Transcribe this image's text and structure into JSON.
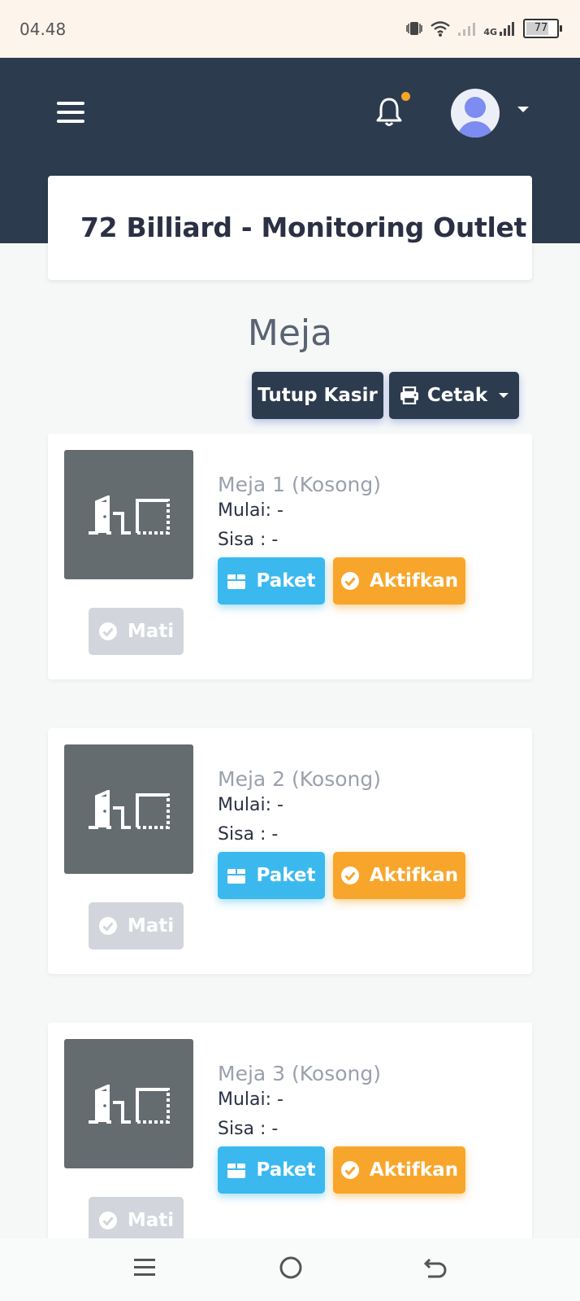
{
  "status_bar": {
    "time": "04.48",
    "network_label": "4G",
    "battery_level": "77"
  },
  "header": {
    "page_title": "72 Billiard - Monitoring Outlet",
    "has_notification": true
  },
  "main": {
    "section_title": "Meja",
    "tutup_kasir_label": "Tutup Kasir",
    "cetak_label": "Cetak",
    "tables": [
      {
        "name": "Meja 1 (Kosong)",
        "mulai": "Mulai: -",
        "sisa": "Sisa : -",
        "paket_label": "Paket",
        "aktifkan_label": "Aktifkan",
        "mati_label": "Mati"
      },
      {
        "name": "Meja 2 (Kosong)",
        "mulai": "Mulai: -",
        "sisa": "Sisa : -",
        "paket_label": "Paket",
        "aktifkan_label": "Aktifkan",
        "mati_label": "Mati"
      },
      {
        "name": "Meja 3 (Kosong)",
        "mulai": "Mulai: -",
        "sisa": "Sisa : -",
        "paket_label": "Paket",
        "aktifkan_label": "Aktifkan",
        "mati_label": "Mati"
      }
    ]
  },
  "colors": {
    "navbar_bg": "#2d3b4f",
    "paket": "#3bb9ef",
    "aktifkan": "#f8a62b",
    "mati_disabled": "#d2d6dc",
    "notification_dot": "#f6a623"
  },
  "icons": {
    "menu": "hamburger-menu-icon",
    "notification": "bell-icon",
    "avatar": "user-avatar-icon",
    "print": "printer-icon",
    "table_thumb": "door-table-icon",
    "paket": "box-icon",
    "aktifkan": "check-circle-icon",
    "mati": "check-circle-icon"
  }
}
